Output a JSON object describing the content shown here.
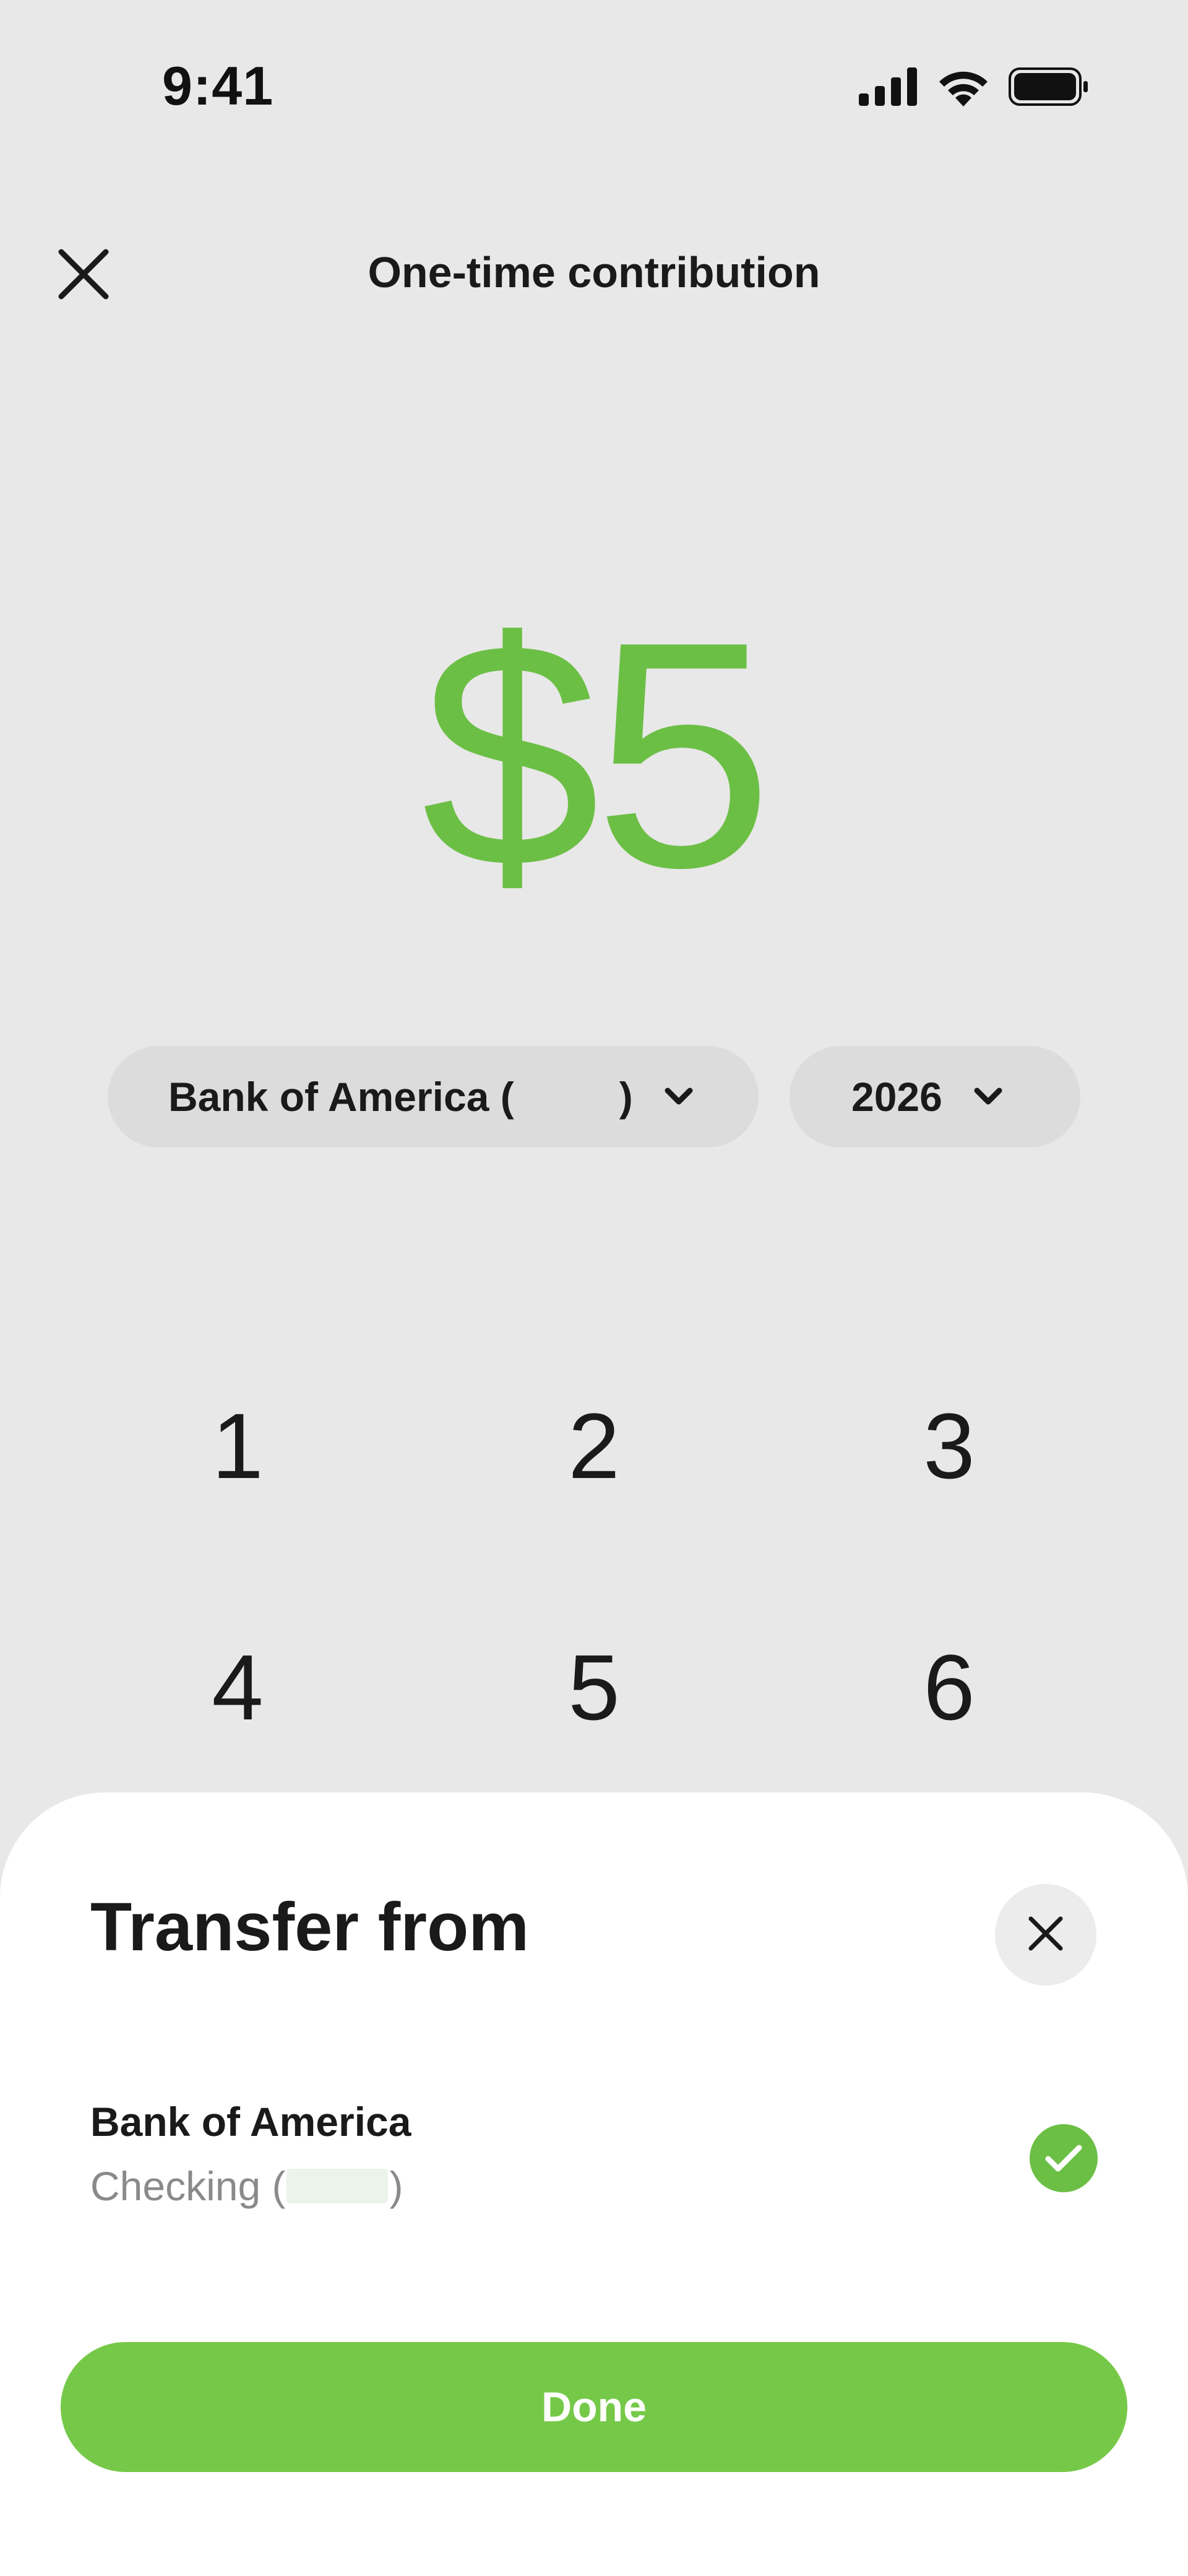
{
  "status_bar": {
    "time": "9:41",
    "icons": [
      "cellular-signal-icon",
      "wifi-icon",
      "battery-icon"
    ]
  },
  "header": {
    "close_icon": "close-icon",
    "title": "One-time contribution"
  },
  "amount": {
    "value": "$5",
    "color": "#6cbf45"
  },
  "selectors": {
    "account_prefix": "Bank of America (",
    "account_suffix": ")",
    "year": "2026"
  },
  "keypad": {
    "keys": [
      "1",
      "2",
      "3",
      "4",
      "5",
      "6"
    ]
  },
  "sheet": {
    "title": "Transfer from",
    "account": {
      "bank": "Bank of America",
      "type_prefix": "Checking (",
      "type_suffix": ")",
      "selected": true
    },
    "done_label": "Done",
    "accent": "#76c948"
  }
}
